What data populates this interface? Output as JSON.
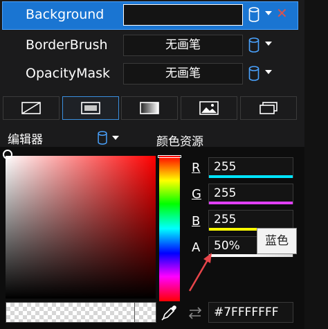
{
  "properties": [
    {
      "label": "Background",
      "value": "",
      "selected": true
    },
    {
      "label": "BorderBrush",
      "value": "无画笔",
      "selected": false
    },
    {
      "label": "OpacityMask",
      "value": "无画笔",
      "selected": false
    }
  ],
  "brush_tabs": [
    {
      "icon": "no-brush-icon",
      "active": false
    },
    {
      "icon": "solid-color-brush-icon",
      "active": true
    },
    {
      "icon": "gradient-brush-icon",
      "active": false
    },
    {
      "icon": "image-brush-icon",
      "active": false
    },
    {
      "icon": "visual-brush-icon",
      "active": false
    }
  ],
  "editor": {
    "title": "编辑器",
    "color_resources_tab": "颜色资源"
  },
  "channels": {
    "r": {
      "label": "R",
      "value": "255",
      "color": "#00e5ff"
    },
    "g": {
      "label": "G",
      "value": "255",
      "color": "#e040fb"
    },
    "b": {
      "label": "B",
      "value": "255",
      "color": "#ffff00"
    },
    "a": {
      "label": "A",
      "value": "50%"
    }
  },
  "tooltip": "蓝色",
  "hex_value": "#7FFFFFFF",
  "colors": {
    "selection": "#1a75d2",
    "close": "#d9534f",
    "accent_icon": "#4aa3ff"
  }
}
